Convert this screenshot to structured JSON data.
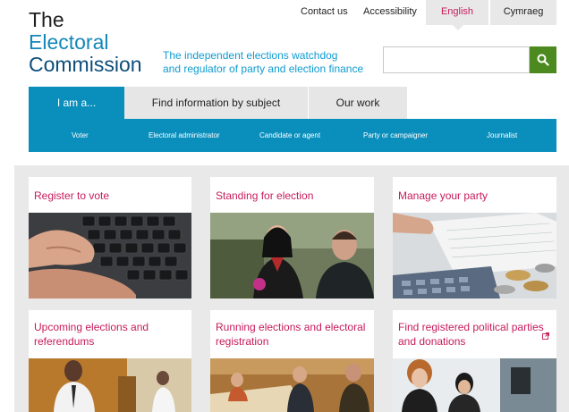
{
  "logo": {
    "line1": "The",
    "line2": "Electoral",
    "line3": "Commission"
  },
  "tagline": {
    "line1": "The independent elections watchdog",
    "line2": "and regulator of party and election finance"
  },
  "toplinks": {
    "contact": "Contact us",
    "accessibility": "Accessibility",
    "english": "English",
    "cymraeg": "Cymraeg"
  },
  "search": {
    "placeholder": "",
    "button_icon": "search-icon"
  },
  "tabs": {
    "iam": "I am a...",
    "find": "Find information by subject",
    "work": "Our work"
  },
  "subnav": [
    "Voter",
    "Electoral administrator",
    "Candidate or agent",
    "Party or campaigner",
    "Journalist"
  ],
  "cards": [
    {
      "title": "Register to vote",
      "image": "hands-on-keyboard"
    },
    {
      "title": "Standing for election",
      "image": "candidate-speaking"
    },
    {
      "title": "Manage your party",
      "image": "calculator-and-coins"
    },
    {
      "title": "Upcoming elections and referendums",
      "image": "polling-station"
    },
    {
      "title": "Running elections and electoral registration",
      "image": "count-officials"
    },
    {
      "title": "Find registered political parties and donations",
      "image": "office-workers",
      "external": true
    }
  ],
  "colors": {
    "brand_blue": "#0a8fbd",
    "accent_pink": "#c61b5a",
    "search_green": "#4c8a1f"
  }
}
